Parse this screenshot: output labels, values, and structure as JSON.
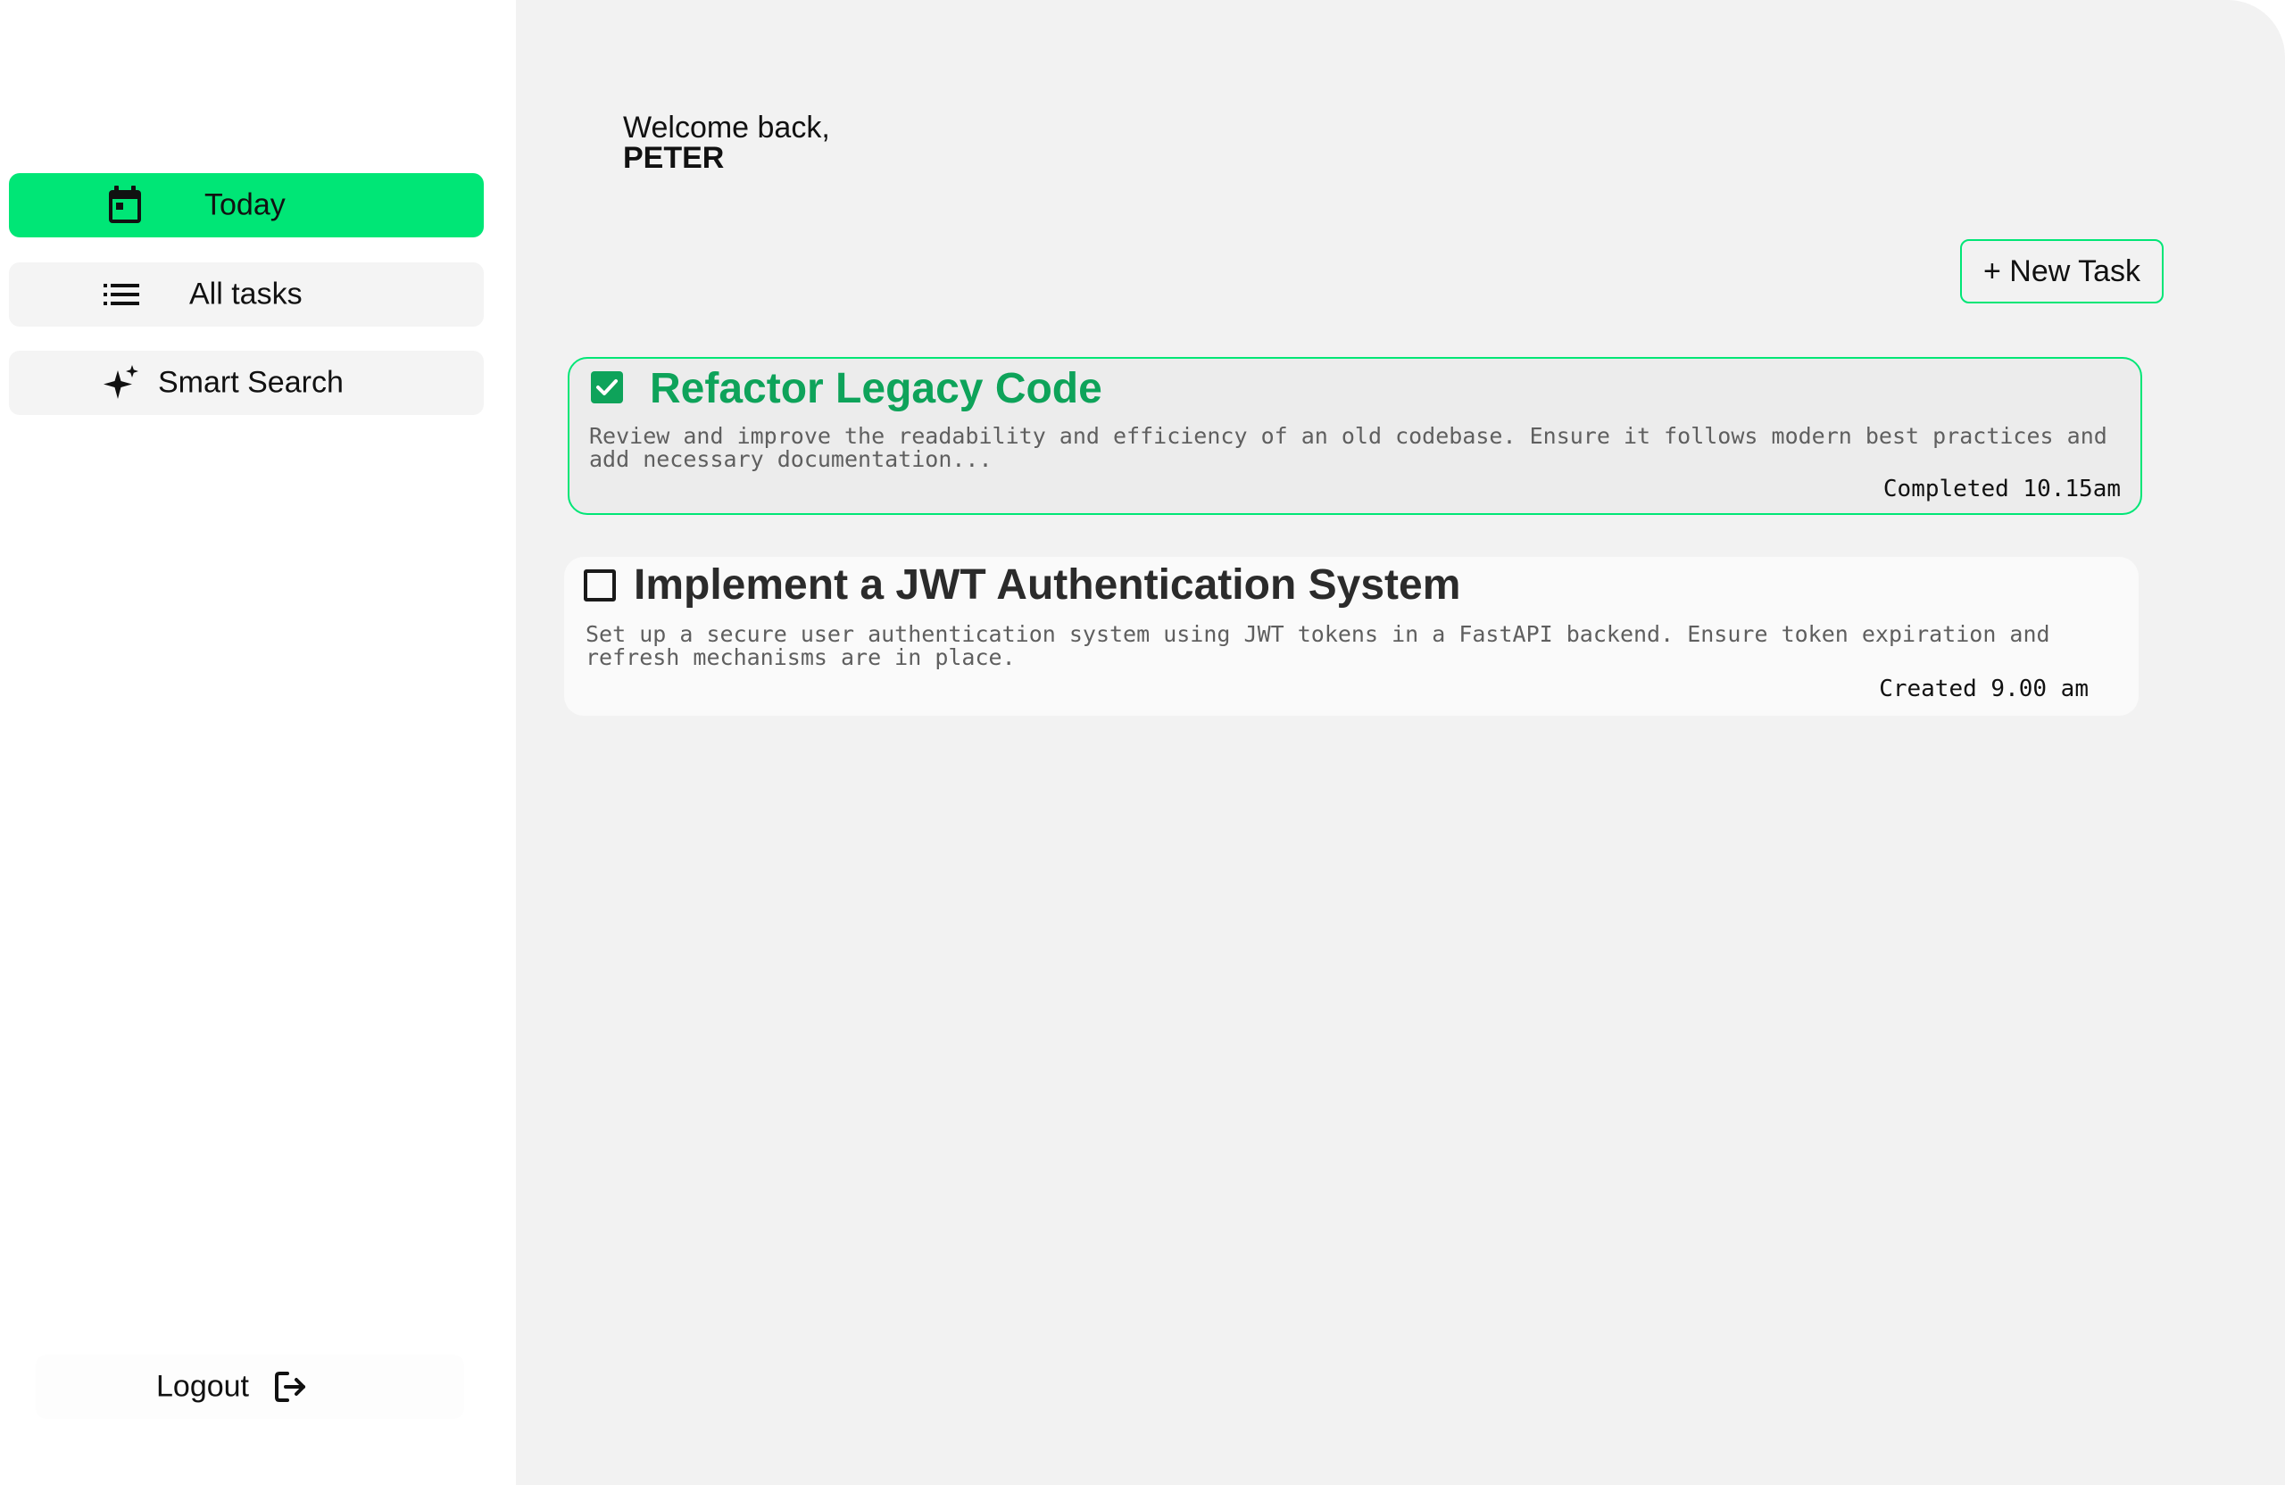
{
  "sidebar": {
    "items": [
      {
        "label": "Today",
        "icon": "calendar-icon",
        "active": true
      },
      {
        "label": "All tasks",
        "icon": "list-icon",
        "active": false
      },
      {
        "label": "Smart Search",
        "icon": "sparkle-icon",
        "active": false
      }
    ],
    "logout": {
      "label": "Logout",
      "icon": "logout-icon"
    }
  },
  "header": {
    "greeting": "Welcome back,",
    "user_name": "PETER"
  },
  "toolbar": {
    "new_task_label": "+ New Task"
  },
  "tasks": [
    {
      "title": "Refactor Legacy Code",
      "description": "Review and improve the readability and efficiency of an old codebase. Ensure it follows modern best practices and add necessary documentation...",
      "status_text": "Completed 10.15am",
      "completed": true
    },
    {
      "title": "Implement a JWT Authentication System",
      "description": "Set up a secure user authentication system using JWT tokens in a FastAPI backend. Ensure token expiration and refresh mechanisms are in place.",
      "status_text": "Created 9.00 am",
      "completed": false
    }
  ],
  "colors": {
    "accent": "#00e676",
    "completed_text": "#0ea35a",
    "main_background": "#f2f2f2"
  }
}
